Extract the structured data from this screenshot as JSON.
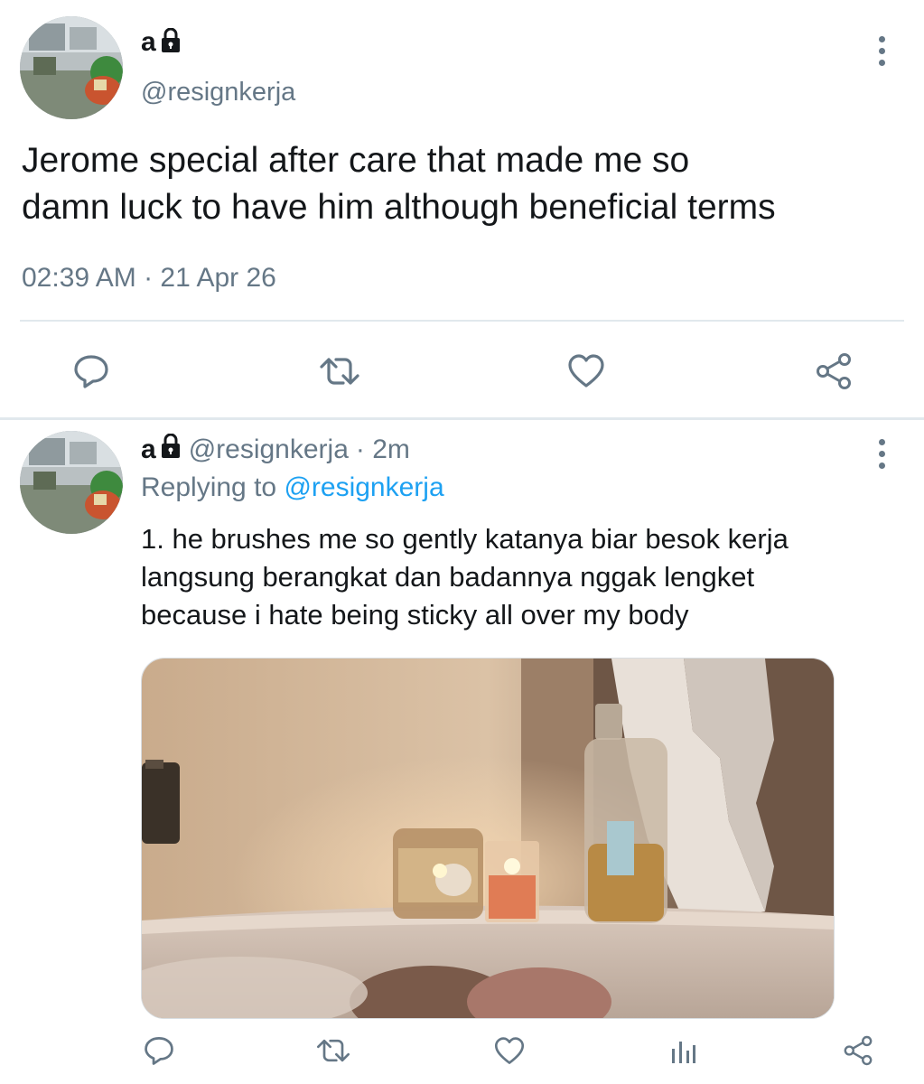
{
  "main_tweet": {
    "display_name": "a",
    "handle": "@resignkerja",
    "text_line1": "Jerome special after care that made me so",
    "text_line2": "damn luck to have him although beneficial terms",
    "timestamp": "02:39 AM · 21 Apr 26",
    "actions": [
      "reply-icon",
      "retweet-icon",
      "like-icon",
      "share-icon"
    ]
  },
  "reply_tweet": {
    "display_name": "a",
    "handle": "@resignkerja",
    "time": "· 2m",
    "replying_label": "Replying to",
    "replying_handle": "@resignkerja",
    "text_line1": "1. he brushes me so gently katanya biar besok kerja",
    "text_line2": "langsung berangkat dan badannya nggak lengket",
    "text_line3": "because i hate being sticky all over my body",
    "actions": [
      "reply-icon",
      "retweet-icon",
      "like-icon",
      "analytics-icon",
      "share-icon"
    ]
  },
  "colors": {
    "text": "#14171a",
    "secondary": "#657786",
    "link": "#1da1f2",
    "divider": "#e1e8ed"
  }
}
